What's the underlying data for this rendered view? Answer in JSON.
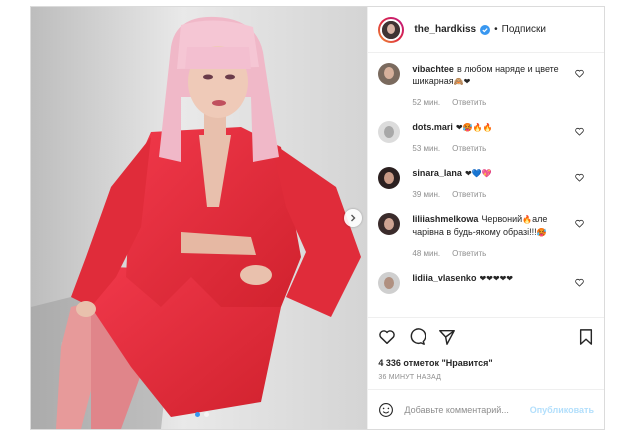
{
  "post": {
    "username": "the_hardkiss",
    "follow_label": "Подписки",
    "likes_text": "4 336 отметок \"Нравится\"",
    "time_text": "36 минут назад",
    "add_comment_placeholder": "Добавьте комментарий...",
    "publish_label": "Опубликовать"
  },
  "comments": [
    {
      "user": "vibachtee",
      "text": "в любом наряде и цвете шикарная",
      "emoji": "🙈❤",
      "time": "52 мин.",
      "reply": "Ответить"
    },
    {
      "user": "dots.mari",
      "text": "",
      "emoji": "❤🥵🔥🔥",
      "time": "53 мин.",
      "reply": "Ответить"
    },
    {
      "user": "sinara_lana",
      "text": "",
      "emoji": "❤💙💖",
      "time": "39 мин.",
      "reply": "Ответить"
    },
    {
      "user": "liliiashmelkowa",
      "text": "Червоний",
      "text2": "але чарівна в будь-якому образі!!!",
      "emoji": "🔥",
      "emoji2": "🥵",
      "time": "48 мин.",
      "reply": "Ответить"
    },
    {
      "user": "lidiia_vlasenko",
      "text": "",
      "emoji": "❤❤❤❤❤",
      "time": "",
      "reply": ""
    }
  ],
  "icons": {
    "heart": "heart-icon",
    "comment": "comment-icon",
    "share": "share-icon",
    "save": "bookmark-icon",
    "emoji": "smiley-icon",
    "verified": "verified-badge-icon",
    "next": "chevron-right-icon"
  },
  "colors": {
    "suit_red": "#e8303c",
    "link_blue": "#3897f0",
    "publish_disabled": "#b2dffc"
  },
  "carousel": {
    "slides": 2,
    "active": 1
  }
}
